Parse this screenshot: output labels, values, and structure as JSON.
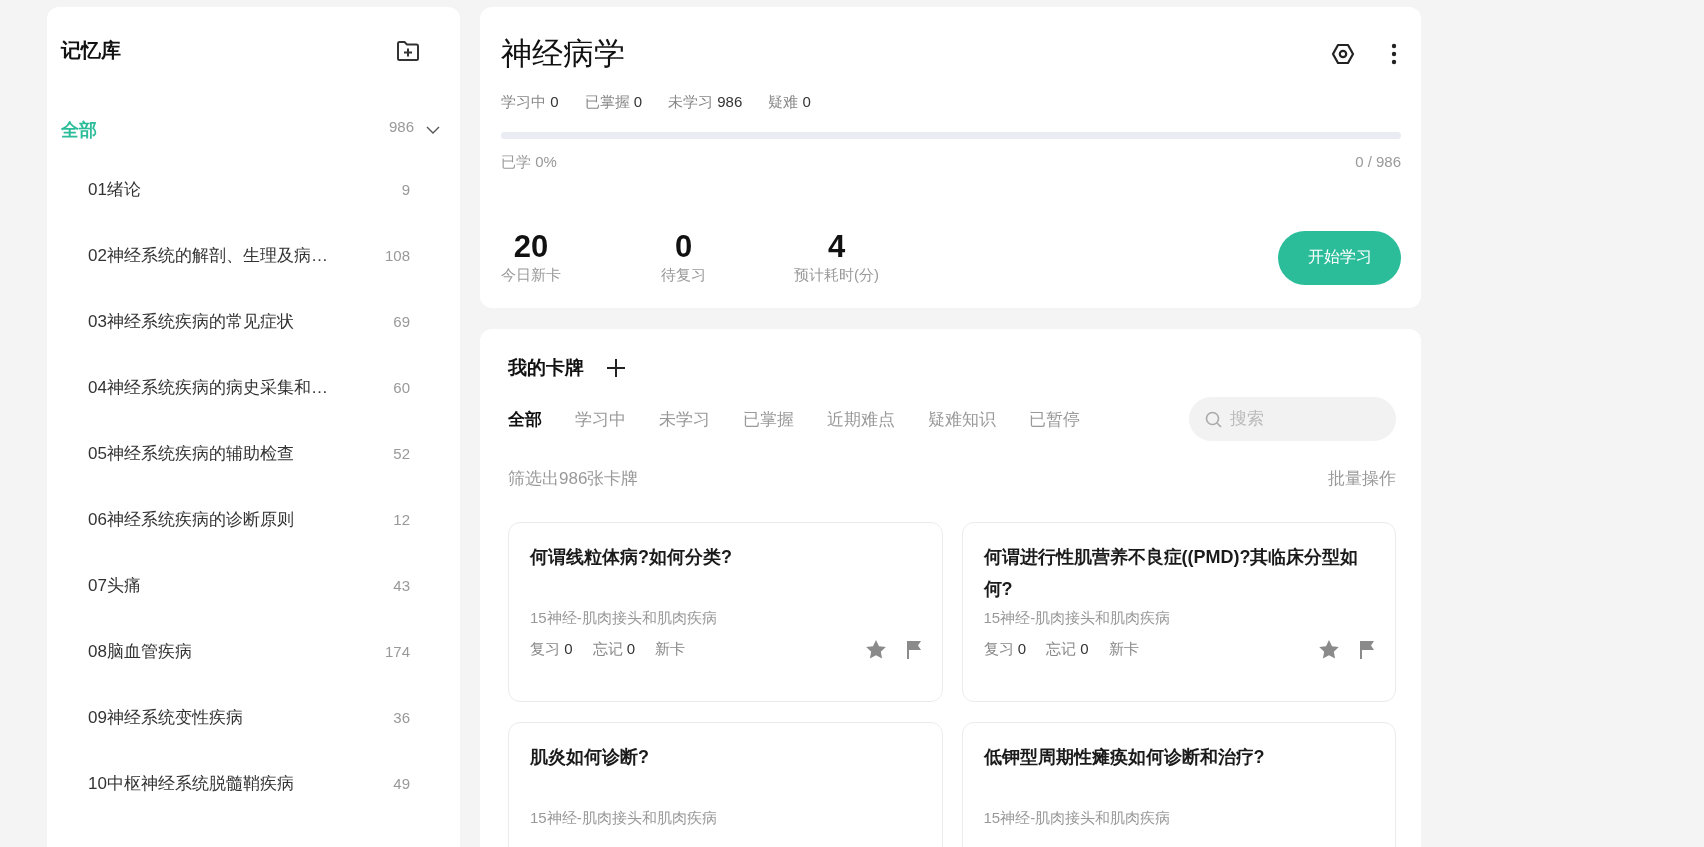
{
  "sidebar": {
    "title": "记忆库",
    "tree": [
      {
        "label": "全部",
        "count": "986",
        "selected": true,
        "expanded": true,
        "children": [
          {
            "label": "01绪论",
            "count": "9",
            "selected": false
          },
          {
            "label": "02神经系统的解剖、生理及病…",
            "count": "108",
            "selected": false
          },
          {
            "label": "03神经系统疾病的常见症状",
            "count": "69",
            "selected": false
          },
          {
            "label": "04神经系统疾病的病史采集和…",
            "count": "60",
            "selected": false
          },
          {
            "label": "05神经系统疾病的辅助检查",
            "count": "52",
            "selected": false
          },
          {
            "label": "06神经系统疾病的诊断原则",
            "count": "12",
            "selected": false
          },
          {
            "label": "07头痛",
            "count": "43",
            "selected": false
          },
          {
            "label": "08脑血管疾病",
            "count": "174",
            "selected": false
          },
          {
            "label": "09神经系统变性疾病",
            "count": "36",
            "selected": false
          },
          {
            "label": "10中枢神经系统脱髓鞘疾病",
            "count": "49",
            "selected": false
          }
        ]
      }
    ]
  },
  "deck": {
    "title": "神经病学",
    "stats": [
      {
        "label": "学习中",
        "value": "0"
      },
      {
        "label": "已掌握",
        "value": "0"
      },
      {
        "label": "未学习",
        "value": "986"
      },
      {
        "label": "疑难",
        "value": "0"
      }
    ],
    "progress": {
      "level": 0,
      "caption": "已学 0%",
      "count": "0 / 986"
    },
    "summary": [
      {
        "value": "20",
        "label": "今日新卡"
      },
      {
        "value": "0",
        "label": "待复习"
      },
      {
        "value": "4",
        "label": "预计耗时(分)"
      }
    ],
    "start_button": "开始学习"
  },
  "cards_panel": {
    "title": "我的卡牌",
    "tabs": [
      {
        "label": "全部",
        "selected": true
      },
      {
        "label": "学习中",
        "selected": false
      },
      {
        "label": "未学习",
        "selected": false
      },
      {
        "label": "已掌握",
        "selected": false
      },
      {
        "label": "近期难点",
        "selected": false
      },
      {
        "label": "疑难知识",
        "selected": false
      },
      {
        "label": "已暂停",
        "selected": false
      }
    ],
    "search": {
      "placeholder": "搜索"
    },
    "filter_text": "筛选出986张卡牌",
    "batch_action": "批量操作",
    "cards": [
      {
        "question": "何谓线粒体病?如何分类?",
        "deck": "15神经-肌肉接头和肌肉疾病",
        "stats": [
          {
            "label": "复习",
            "value": "0"
          },
          {
            "label": "忘记",
            "value": "0"
          }
        ],
        "status": "新卡"
      },
      {
        "question": "何谓进行性肌营养不良症((PMD)?其临床分型如何?",
        "deck": "15神经-肌肉接头和肌肉疾病",
        "stats": [
          {
            "label": "复习",
            "value": "0"
          },
          {
            "label": "忘记",
            "value": "0"
          }
        ],
        "status": "新卡"
      },
      {
        "question": "肌炎如何诊断?",
        "deck": "15神经-肌肉接头和肌肉疾病"
      },
      {
        "question": "低钾型周期性瘫痪如何诊断和治疗?",
        "deck": "15神经-肌肉接头和肌肉疾病"
      }
    ]
  }
}
